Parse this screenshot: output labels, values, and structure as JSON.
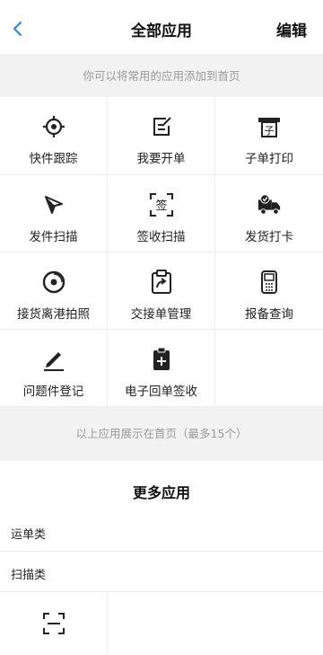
{
  "header": {
    "title": "全部应用",
    "edit_label": "编辑"
  },
  "hints": {
    "top": "你可以将常用的应用添加到首页",
    "bottom": "以上应用展示在首页（最多15个）"
  },
  "apps": [
    {
      "label": "快件跟踪",
      "icon": "target-icon"
    },
    {
      "label": "我要开单",
      "icon": "edit-note-icon"
    },
    {
      "label": "子单打印",
      "icon": "printer-icon"
    },
    {
      "label": "发件扫描",
      "icon": "cursor-arrow-icon"
    },
    {
      "label": "签收扫描",
      "icon": "sign-scan-icon"
    },
    {
      "label": "发货打卡",
      "icon": "truck-check-icon"
    },
    {
      "label": "接货离港拍照",
      "icon": "camera-lens-icon"
    },
    {
      "label": "交接单管理",
      "icon": "clipboard-arrow-icon"
    },
    {
      "label": "报备查询",
      "icon": "handheld-device-icon"
    },
    {
      "label": "问题件登记",
      "icon": "pencil-icon"
    },
    {
      "label": "电子回单签收",
      "icon": "clipboard-plus-icon"
    }
  ],
  "more": {
    "title": "更多应用",
    "categories": [
      "运单类",
      "扫描类"
    ],
    "scan_item_icon": "scan-frame-icon"
  },
  "colors": {
    "accent": "#2b8ce8",
    "icon": "#222222",
    "hint_text": "#9a9a9a",
    "background": "#f2f2f2"
  }
}
